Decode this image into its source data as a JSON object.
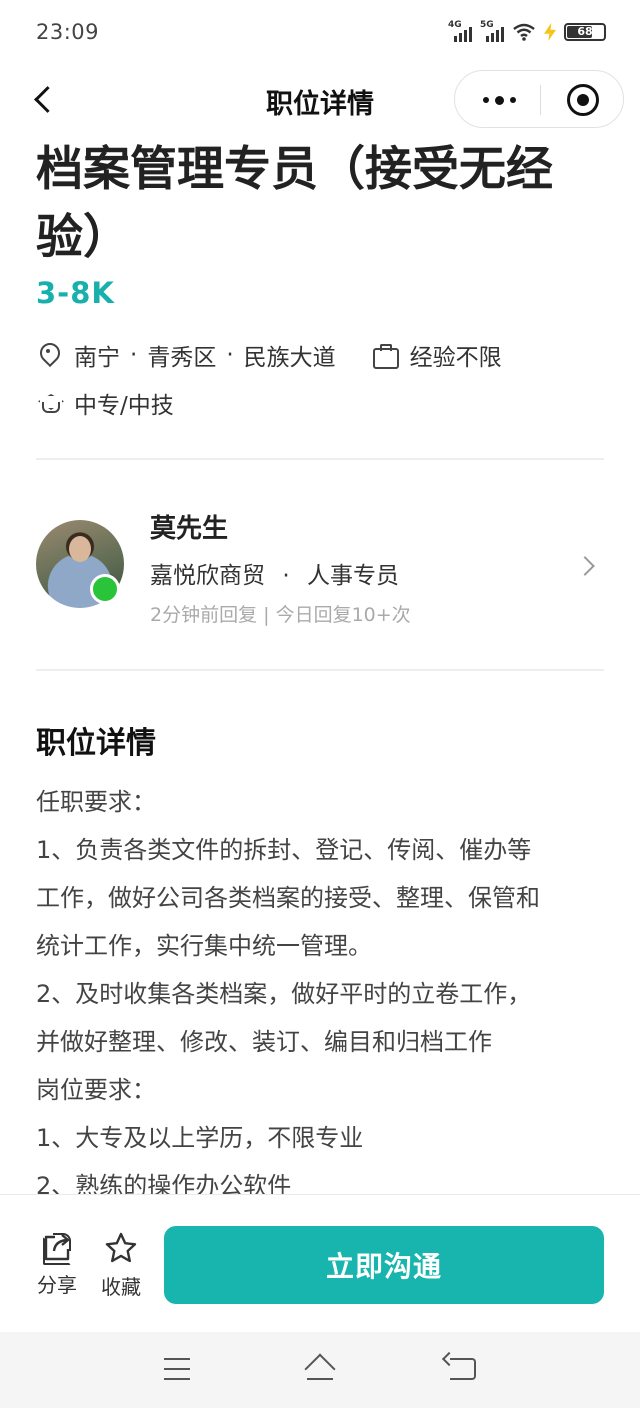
{
  "status_bar": {
    "time": "23:09",
    "signal_1_label": "4G",
    "signal_2_label": "5G",
    "battery_level": "68",
    "icons": [
      "signal-4g-icon",
      "signal-5g-icon",
      "wifi-icon",
      "charging-bolt-icon",
      "battery-icon"
    ]
  },
  "nav": {
    "title": "职位详情",
    "icons": [
      "back-arrow-icon",
      "more-dots-icon",
      "close-target-icon"
    ]
  },
  "job": {
    "title": "档案管理专员（接受无经验）",
    "salary": "3-8K",
    "location": {
      "city": "南宁",
      "district": "青秀区",
      "street": "民族大道"
    },
    "separator": "·",
    "experience": "经验不限",
    "education": "中专/中技"
  },
  "recruiter": {
    "name": "莫先生",
    "company": "嘉悦欣商贸",
    "role": "人事专员",
    "reply_info": "2分钟前回复 | 今日回复10+次",
    "online": true
  },
  "description": {
    "section_title": "职位详情",
    "lines": [
      "任职要求：",
      "1、负责各类文件的拆封、登记、传阅、催办等",
      "工作，做好公司各类档案的接受、整理、保管和",
      "统计工作，实行集中统一管理。",
      "2、及时收集各类档案，做好平时的立卷工作，",
      "并做好整理、修改、装订、编目和归档工作",
      "岗位要求：",
      "1、大专及以上学历，不限专业",
      "2、熟练的操作办公软件"
    ]
  },
  "actions": {
    "share_label": "分享",
    "favorite_label": "收藏",
    "cta_label": "立即沟通"
  },
  "colors": {
    "accent": "#17b5ae",
    "online": "#2ac43a"
  }
}
